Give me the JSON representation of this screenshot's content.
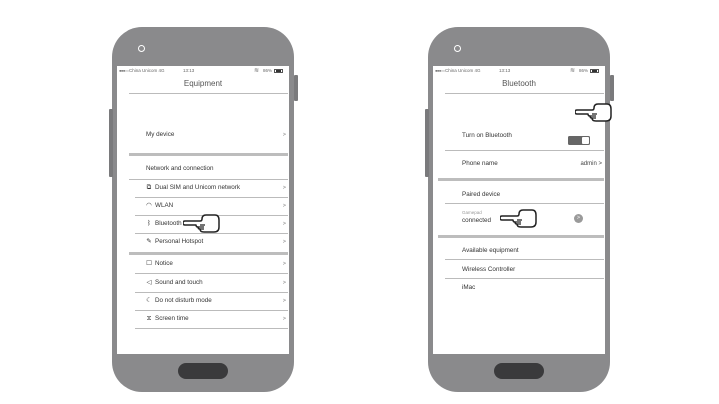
{
  "left_phone": {
    "status": {
      "signal": "●●●○○",
      "carrier": "China Unicom 4G",
      "time": "13:13",
      "battery": "86%"
    },
    "title": "Equipment",
    "items": [
      {
        "label": "My device",
        "chevron": ">"
      },
      {
        "label": "Network and connection"
      },
      {
        "label": "Dual SIM and Unicom network",
        "chevron": ">",
        "icon": "sim-icon"
      },
      {
        "label": "WLAN",
        "chevron": ">",
        "icon": "wifi-icon"
      },
      {
        "label": "Bluetooth",
        "chevron": ">",
        "icon": "bluetooth-icon"
      },
      {
        "label": "Personal Hotspot",
        "chevron": ">",
        "icon": "link-icon"
      },
      {
        "label": "Notice",
        "chevron": ">",
        "icon": "notice-icon"
      },
      {
        "label": "Sound and touch",
        "chevron": ">",
        "icon": "speaker-icon"
      },
      {
        "label": "Do not disturb mode",
        "chevron": ">",
        "icon": "moon-icon"
      },
      {
        "label": "Screen time",
        "chevron": ">",
        "icon": "hourglass-icon"
      }
    ]
  },
  "right_phone": {
    "status": {
      "signal": "●●●○○",
      "carrier": "China Unicom 4G",
      "time": "13:13",
      "battery": "86%"
    },
    "title": "Bluetooth",
    "turn_on": {
      "label": "Turn on Bluetooth",
      "state": "on"
    },
    "phone_name": {
      "label": "Phone name",
      "value": "admin",
      "chevron": ">"
    },
    "paired_header": "Paired device",
    "paired_device": {
      "name": "Gamepad",
      "status": "connected",
      "badge": ">"
    },
    "available_header": "Available equipment",
    "available": [
      "Wireless Controller",
      "iMac"
    ]
  },
  "colors": {
    "phone_body": "#8a8a8c",
    "home_button": "#3a3a3c",
    "divider": "#bdbdbd",
    "toggle_on": "#666666"
  }
}
